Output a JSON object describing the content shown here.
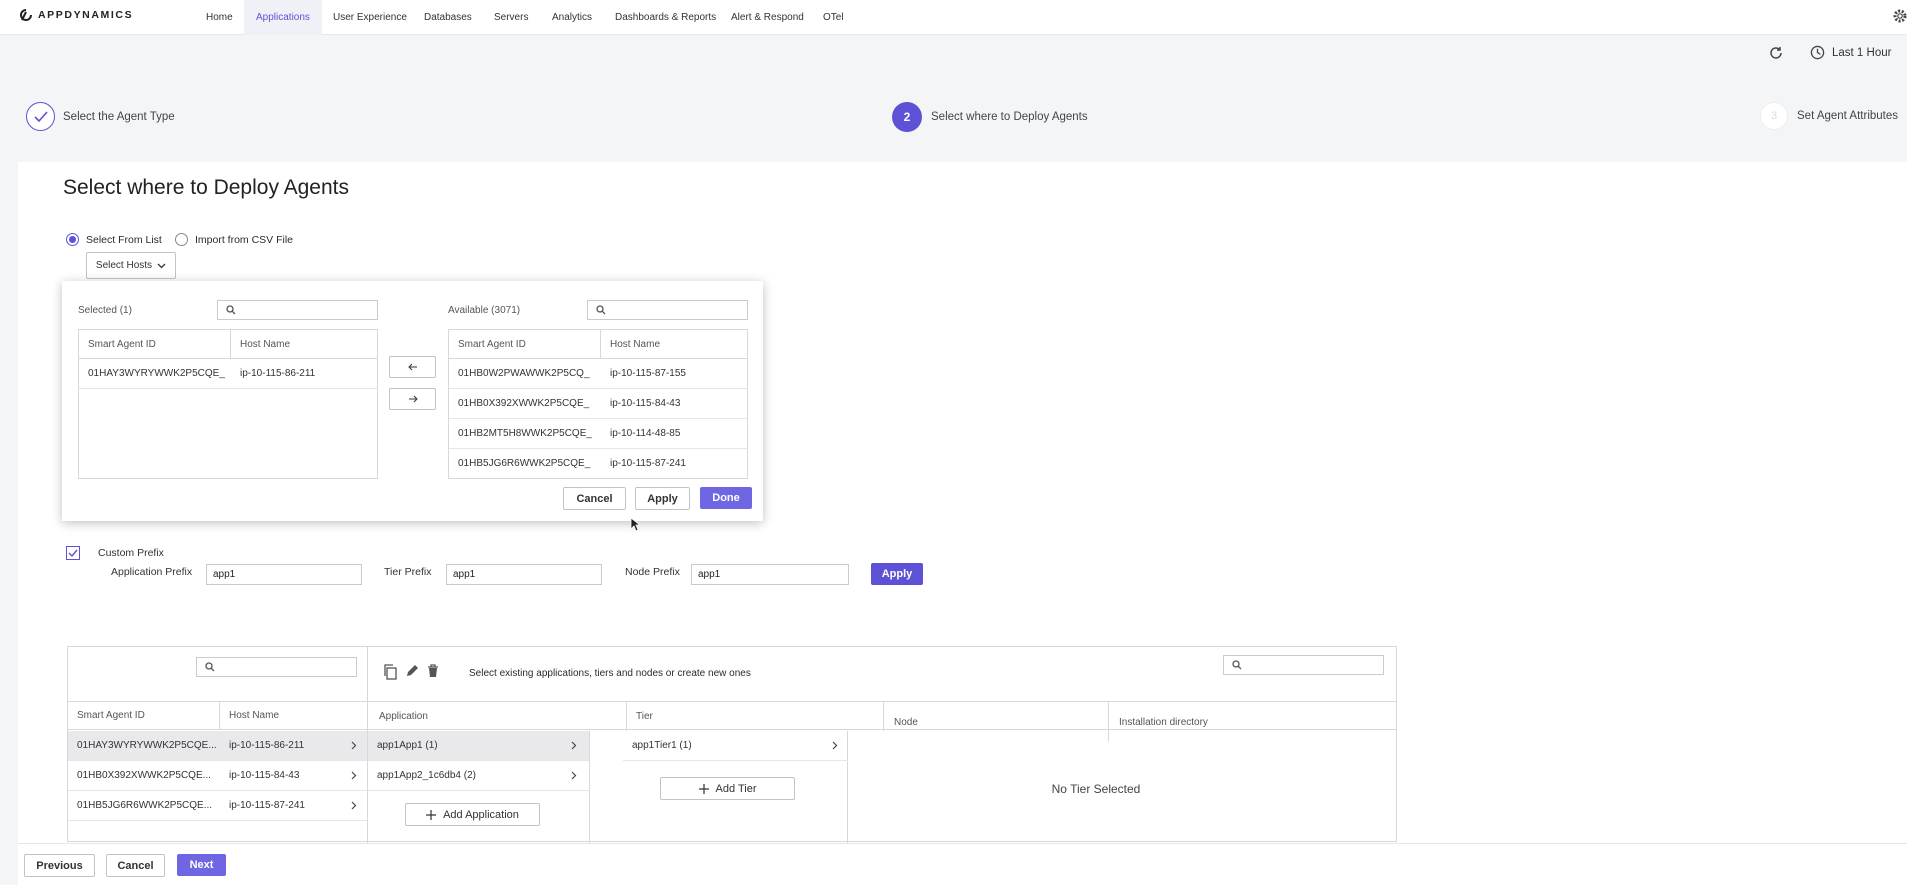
{
  "nav": {
    "brand": "APPDYNAMICS",
    "items": [
      "Home",
      "Applications",
      "User Experience",
      "Databases",
      "Servers",
      "Analytics",
      "Dashboards & Reports",
      "Alert & Respond",
      "OTel"
    ],
    "active": "Applications"
  },
  "toolbar": {
    "time_range": "Last 1 Hour"
  },
  "stepper": {
    "step1": "Select the Agent Type",
    "step2_number": "2",
    "step2": "Select where to Deploy Agents",
    "step3_number": "3",
    "step3": "Set Agent Attributes"
  },
  "page_title": "Select where to Deploy Agents",
  "source": {
    "option1": "Select From List",
    "option2": "Import from CSV File",
    "selected": "Select From List"
  },
  "select_hosts_button": "Select Hosts",
  "popup": {
    "selected_title": "Selected (1)",
    "available_title": "Available (3071)",
    "col_agent": "Smart Agent ID",
    "col_host": "Host Name",
    "selected_rows": [
      {
        "agent": "01HAY3WYRYWWK2P5CQE_",
        "host": "ip-10-115-86-211"
      }
    ],
    "available_rows": [
      {
        "agent": "01HB0W2PWAWWK2P5CQ_",
        "host": "ip-10-115-87-155"
      },
      {
        "agent": "01HB0X392XWWK2P5CQE_",
        "host": "ip-10-115-84-43"
      },
      {
        "agent": "01HB2MT5H8WWK2P5CQE_",
        "host": "ip-10-114-48-85"
      },
      {
        "agent": "01HB5JG6R6WWK2P5CQE_",
        "host": "ip-10-115-87-241"
      }
    ],
    "cancel": "Cancel",
    "apply": "Apply",
    "done": "Done"
  },
  "prefix": {
    "label": "Custom Prefix",
    "checked": true,
    "app_label": "Application Prefix",
    "app_value": "app1",
    "tier_label": "Tier Prefix",
    "tier_value": "app1",
    "node_label": "Node Prefix",
    "node_value": "app1",
    "apply": "Apply"
  },
  "mapping": {
    "hint": "Select existing applications, tiers and nodes or create new ones",
    "col_agent": "Smart Agent ID",
    "col_host": "Host Name",
    "col_application": "Application",
    "col_tier": "Tier",
    "col_node": "Node",
    "col_install": "Installation directory",
    "hosts": [
      {
        "agent": "01HAY3WYRYWWK2P5CQE...",
        "host": "ip-10-115-86-211"
      },
      {
        "agent": "01HB0X392XWWK2P5CQE...",
        "host": "ip-10-115-84-43"
      },
      {
        "agent": "01HB5JG6R6WWK2P5CQE...",
        "host": "ip-10-115-87-241"
      }
    ],
    "applications": [
      "app1App1 (1)",
      "app1App2_1c6db4 (2)"
    ],
    "add_application": "Add Application",
    "tiers": [
      "app1Tier1 (1)"
    ],
    "add_tier": "Add Tier",
    "no_tier": "No Tier Selected"
  },
  "footer": {
    "previous": "Previous",
    "cancel": "Cancel",
    "next": "Next"
  },
  "colors": {
    "accent": "#5d52d6",
    "accent_light": "#6f66e3"
  }
}
